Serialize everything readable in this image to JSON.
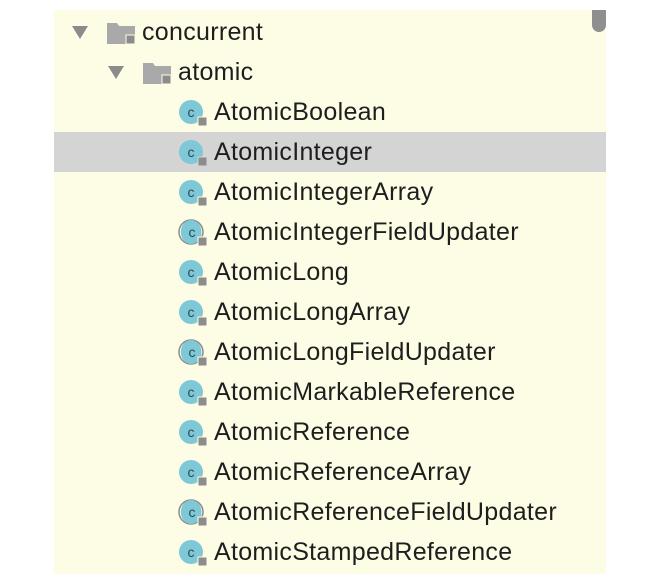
{
  "tree": {
    "folders": [
      {
        "label": "concurrent",
        "icon": "folder-icon",
        "expanded": true
      },
      {
        "label": "atomic",
        "icon": "folder-icon",
        "expanded": true
      }
    ],
    "classes": [
      {
        "label": "AtomicBoolean",
        "icon": "class-icon",
        "abstract": false
      },
      {
        "label": "AtomicInteger",
        "icon": "class-icon",
        "abstract": false,
        "selected": true
      },
      {
        "label": "AtomicIntegerArray",
        "icon": "class-icon",
        "abstract": false
      },
      {
        "label": "AtomicIntegerFieldUpdater",
        "icon": "abstract-class-icon",
        "abstract": true
      },
      {
        "label": "AtomicLong",
        "icon": "class-icon",
        "abstract": false
      },
      {
        "label": "AtomicLongArray",
        "icon": "class-icon",
        "abstract": false
      },
      {
        "label": "AtomicLongFieldUpdater",
        "icon": "abstract-class-icon",
        "abstract": true
      },
      {
        "label": "AtomicMarkableReference",
        "icon": "class-icon",
        "abstract": false
      },
      {
        "label": "AtomicReference",
        "icon": "class-icon",
        "abstract": false
      },
      {
        "label": "AtomicReferenceArray",
        "icon": "class-icon",
        "abstract": false
      },
      {
        "label": "AtomicReferenceFieldUpdater",
        "icon": "abstract-class-icon",
        "abstract": true
      },
      {
        "label": "AtomicStampedReference",
        "icon": "class-icon",
        "abstract": false
      }
    ]
  },
  "colors": {
    "panel_background": "#fdfde6",
    "selection": "#d4d4d4",
    "class_icon": "#7ec8d8",
    "folder_icon": "#a9a9a9",
    "lock_badge": "#8c8c8c"
  }
}
